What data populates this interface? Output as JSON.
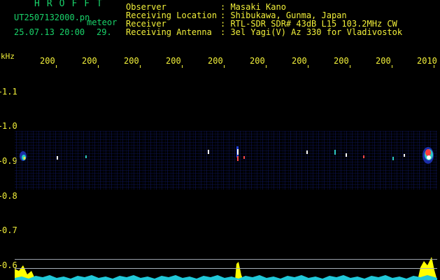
{
  "header": {
    "app_title": "HROFFT",
    "filename": "UT2507132000.pn",
    "meteor_label": "meteor",
    "datetime": "25.07.13 20:00",
    "count": "29.",
    "metadata": [
      {
        "label": "Observer",
        "value": ": Masaki Kano"
      },
      {
        "label": "Receiving Location",
        "value": ": Shibukawa, Gunma, Japan"
      },
      {
        "label": "Receiver",
        "value": ": RTL-SDR SDR# 43dB L15 103.2MHz CW"
      },
      {
        "label": "Receiving Antenna",
        "value": ": 3el Yagi(V) Az 330 for Vladivostok"
      }
    ]
  },
  "spectrogram": {
    "unit_label": "kHz",
    "x_ticks": [
      "200",
      "200",
      "200",
      "200",
      "200",
      "200",
      "200",
      "200",
      "200",
      "2010"
    ],
    "y_ticks": [
      "1.1",
      "1.0",
      "0.9",
      "0.8",
      "0.7",
      "0.6"
    ],
    "colors": {
      "text": "#f2f03a",
      "header_accent": "#19d36a",
      "background": "#000000",
      "signal_low": "#1b2ea8",
      "signal_high": "#ff2a2a",
      "activity": "#ffff00",
      "noise_floor": "#20c8d8"
    }
  }
}
